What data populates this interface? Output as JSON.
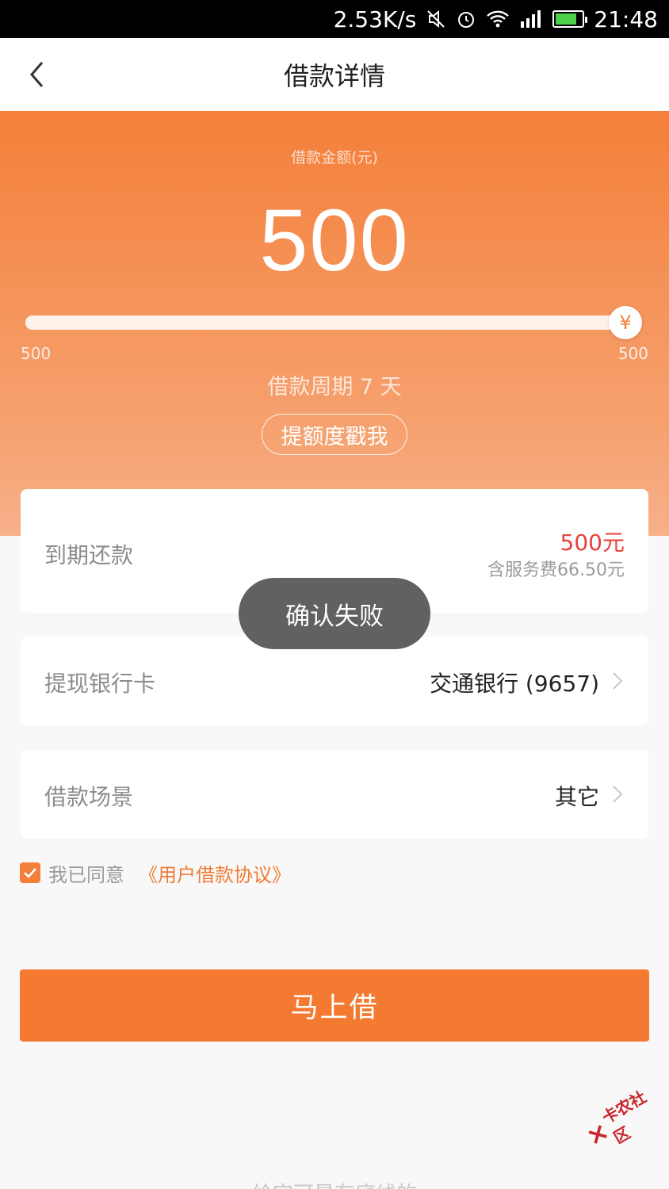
{
  "status_bar": {
    "speed": "2.53K/s",
    "time": "21:48",
    "icons": [
      "mute-icon",
      "alarm-icon",
      "wifi-icon",
      "signal-icon",
      "battery-icon"
    ]
  },
  "header": {
    "title": "借款详情",
    "back_icon": "chevron-left-icon"
  },
  "hero": {
    "amount_label": "借款金额(元)",
    "amount_value": "500",
    "slider": {
      "min_label": "500",
      "max_label": "500",
      "value": 500,
      "min": 500,
      "max": 500,
      "thumb_symbol": "¥"
    },
    "period_text": "借款周期 7 天",
    "raise_button": "提额度戳我"
  },
  "due": {
    "label": "到期还款",
    "amount": "500元",
    "fee": "含服务费66.50元"
  },
  "bank": {
    "label": "提现银行卡",
    "value": "交通银行 (9657)"
  },
  "scene": {
    "label": "借款场景",
    "value": "其它"
  },
  "agreement": {
    "checked": true,
    "text": "我已同意",
    "link": "《用户借款协议》"
  },
  "submit_button": "马上借",
  "toast": "确认失败",
  "footer_text": "给宝可是有底线的",
  "watermark": {
    "text": "卡农社区"
  },
  "colors": {
    "accent": "#f47a31",
    "due_amount": "#e6423b",
    "toast_bg": "#616161"
  }
}
